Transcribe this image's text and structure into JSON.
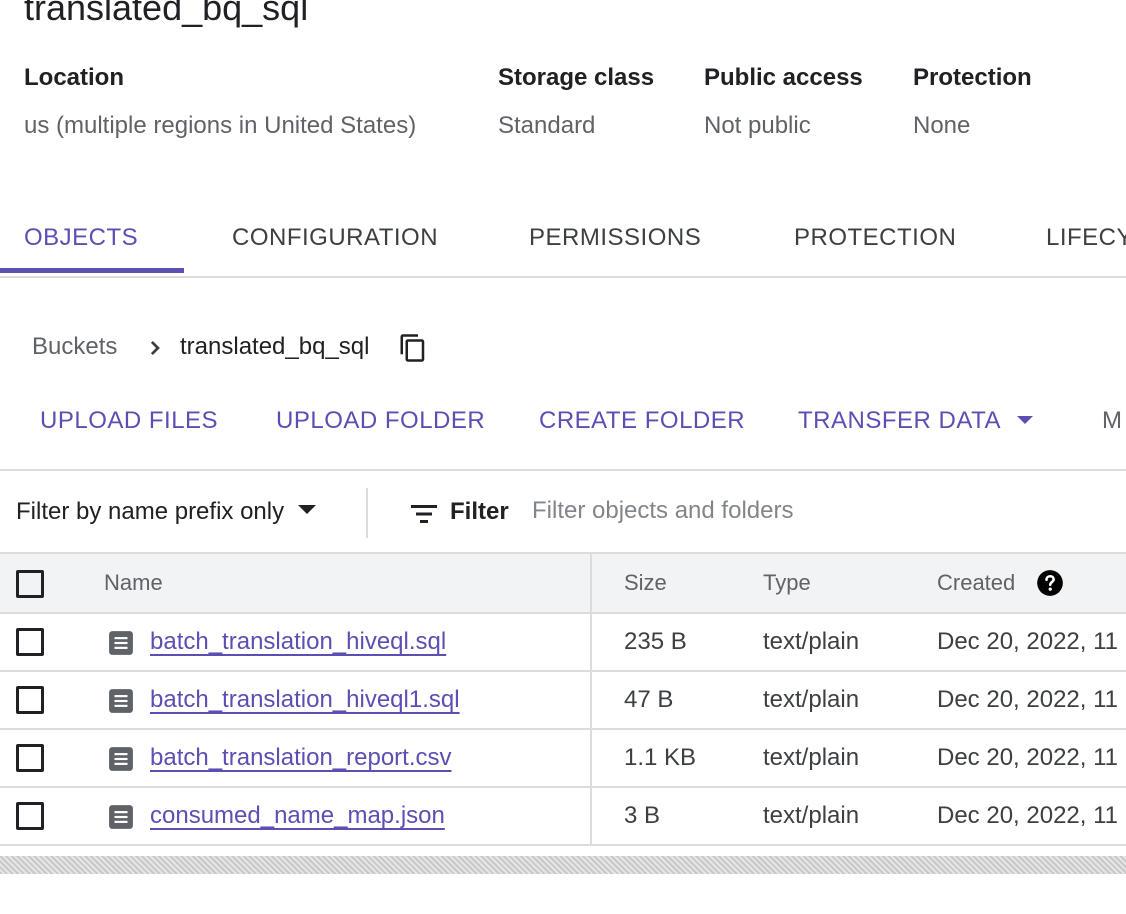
{
  "bucket": {
    "title": "translated_bq_sql",
    "details": [
      {
        "label": "Location",
        "value": "us (multiple regions in United States)"
      },
      {
        "label": "Storage class",
        "value": "Standard"
      },
      {
        "label": "Public access",
        "value": "Not public"
      },
      {
        "label": "Protection",
        "value": "None"
      }
    ]
  },
  "tabs": [
    {
      "label": "OBJECTS",
      "active": true
    },
    {
      "label": "CONFIGURATION"
    },
    {
      "label": "PERMISSIONS"
    },
    {
      "label": "PROTECTION"
    },
    {
      "label": "LIFECY"
    }
  ],
  "breadcrumb": {
    "root": "Buckets",
    "current": "translated_bq_sql"
  },
  "actions": {
    "upload_files": "UPLOAD FILES",
    "upload_folder": "UPLOAD FOLDER",
    "create_folder": "CREATE FOLDER",
    "transfer_data": "TRANSFER DATA",
    "more": "M"
  },
  "filter": {
    "mode": "Filter by name prefix only",
    "button": "Filter",
    "placeholder": "Filter objects and folders"
  },
  "table": {
    "columns": {
      "name": "Name",
      "size": "Size",
      "type": "Type",
      "created": "Created"
    },
    "rows": [
      {
        "name": "batch_translation_hiveql.sql",
        "size": "235 B",
        "type": "text/plain",
        "created": "Dec 20, 2022, 11"
      },
      {
        "name": "batch_translation_hiveql1.sql",
        "size": "47 B",
        "type": "text/plain",
        "created": "Dec 20, 2022, 11"
      },
      {
        "name": "batch_translation_report.csv",
        "size": "1.1 KB",
        "type": "text/plain",
        "created": "Dec 20, 2022, 11"
      },
      {
        "name": "consumed_name_map.json",
        "size": "3 B",
        "type": "text/plain",
        "created": "Dec 20, 2022, 11"
      }
    ]
  },
  "icons": {
    "chevron": "chevron-right-icon",
    "copy": "copy-icon",
    "filter": "filter-icon",
    "file": "file-icon",
    "help": "help-icon"
  },
  "colors": {
    "accent": "#5b4fb4",
    "border": "#dadce0",
    "header_bg": "#f1f3f4"
  }
}
